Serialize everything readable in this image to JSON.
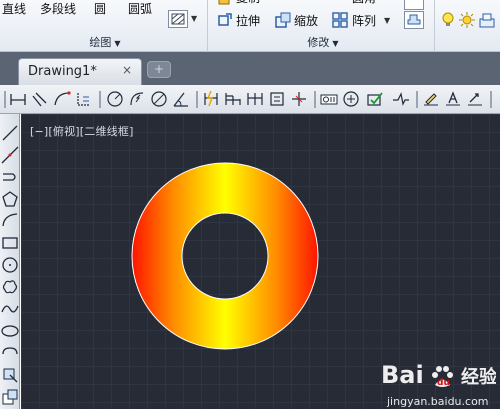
{
  "ribbon": {
    "draw_group": {
      "line_label": "直线",
      "polyline_label": "多段线",
      "circle_label": "圆",
      "arc_label": "圆弧",
      "caption": "绘图"
    },
    "modify_group": {
      "stretch_label": "拉伸",
      "scale_label": "缩放",
      "array_label": "阵列",
      "caption": "修改"
    },
    "top_cutoff_labels": [
      "复制",
      "圆角"
    ]
  },
  "tabs": {
    "drawing_tab_label": "Drawing1*",
    "close_glyph": "×",
    "new_tab_glyph": "+"
  },
  "viewport": {
    "label": "[−][俯视][二维线框]"
  },
  "canvas": {
    "background_color": "#262b36",
    "grid_color": "#2f3542",
    "donut_gradient": [
      "#ff1500",
      "#ff8a00",
      "#ffff00",
      "#ff8a00",
      "#ff1500"
    ]
  },
  "watermark": {
    "text": "jingyan.baidu.com"
  }
}
